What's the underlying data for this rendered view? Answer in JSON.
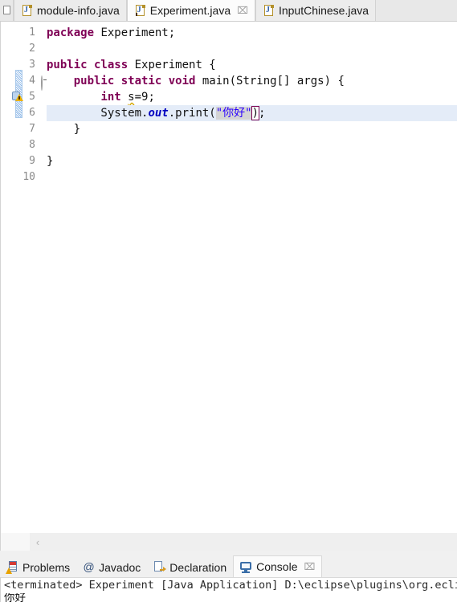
{
  "window": {
    "app": "Eclipse IDE",
    "edge_stub_icon": "partial-view-icon"
  },
  "editor_tabs": {
    "items": [
      {
        "label": "module-info.java",
        "icon": "java-file-icon",
        "active": false,
        "warning": false,
        "closable": false
      },
      {
        "label": "Experiment.java",
        "icon": "java-file-warning-icon",
        "active": true,
        "warning": true,
        "closable": true,
        "close_label": "⌧"
      },
      {
        "label": "InputChinese.java",
        "icon": "java-file-icon",
        "active": false,
        "warning": false,
        "closable": false
      }
    ]
  },
  "editor": {
    "gutter": {
      "line_numbers": [
        "1",
        "2",
        "3",
        "4",
        "5",
        "6",
        "7",
        "8",
        "9",
        "10"
      ],
      "fold_marker_line": "4",
      "fold_marker_icon": "collapse-fold-icon",
      "warning_marker_line": "5",
      "warning_marker_icon": "quickfix-warning-icon",
      "change_bar_name": "change-ruler"
    },
    "lines": [
      {
        "n": 1,
        "parts": [
          {
            "t": "package",
            "c": "kw"
          },
          {
            "t": " Experiment;",
            "c": ""
          }
        ]
      },
      {
        "n": 2,
        "parts": [
          {
            "t": "",
            "c": ""
          }
        ]
      },
      {
        "n": 3,
        "parts": [
          {
            "t": "public class",
            "c": "kw"
          },
          {
            "t": " Experiment {",
            "c": ""
          }
        ]
      },
      {
        "n": 4,
        "parts": [
          {
            "t": "    ",
            "c": ""
          },
          {
            "t": "public static void",
            "c": "kw"
          },
          {
            "t": " main(String[] args) {",
            "c": ""
          }
        ]
      },
      {
        "n": 5,
        "parts": [
          {
            "t": "        ",
            "c": ""
          },
          {
            "t": "int",
            "c": "kw"
          },
          {
            "t": " ",
            "c": ""
          },
          {
            "t": "s",
            "c": "warnu"
          },
          {
            "t": "=9;",
            "c": ""
          }
        ]
      },
      {
        "n": 6,
        "parts": [
          {
            "t": "        System.",
            "c": ""
          },
          {
            "t": "out",
            "c": "fld"
          },
          {
            "t": ".print(",
            "c": ""
          },
          {
            "t": "\"你好\"",
            "c": "str strhl"
          },
          {
            "t": ")",
            "c": "bracketbox"
          },
          {
            "t": ";",
            "c": ""
          }
        ]
      },
      {
        "n": 7,
        "parts": [
          {
            "t": "    }",
            "c": ""
          }
        ]
      },
      {
        "n": 8,
        "parts": [
          {
            "t": "",
            "c": ""
          }
        ]
      },
      {
        "n": 9,
        "parts": [
          {
            "t": "}",
            "c": ""
          }
        ]
      },
      {
        "n": 10,
        "parts": [
          {
            "t": "",
            "c": ""
          }
        ]
      }
    ],
    "current_line": 6,
    "scrollbar": {
      "left_arrow": "‹"
    }
  },
  "view_tabs": {
    "items": [
      {
        "label": "Problems",
        "icon": "problems-icon",
        "active": false
      },
      {
        "label": "Javadoc",
        "icon": "javadoc-at-icon",
        "active": false
      },
      {
        "label": "Declaration",
        "icon": "declaration-icon",
        "active": false
      },
      {
        "label": "Console",
        "icon": "console-icon",
        "active": true,
        "close_label": "⌧"
      }
    ]
  },
  "console": {
    "header": "<terminated> Experiment [Java Application] D:\\eclipse\\plugins\\org.eclipse.j",
    "output": "你好"
  },
  "colors": {
    "keyword": "#7F0055",
    "string": "#2A00FF",
    "static_field": "#0000C0",
    "current_line": "#E4ECF8",
    "occurrence_highlight": "#D4D4D4",
    "bracket_box": "#7A004F",
    "warning": "#E8A200",
    "tab_active_bg": "#FCFCFC",
    "chrome_bg": "#F0F0F0"
  }
}
